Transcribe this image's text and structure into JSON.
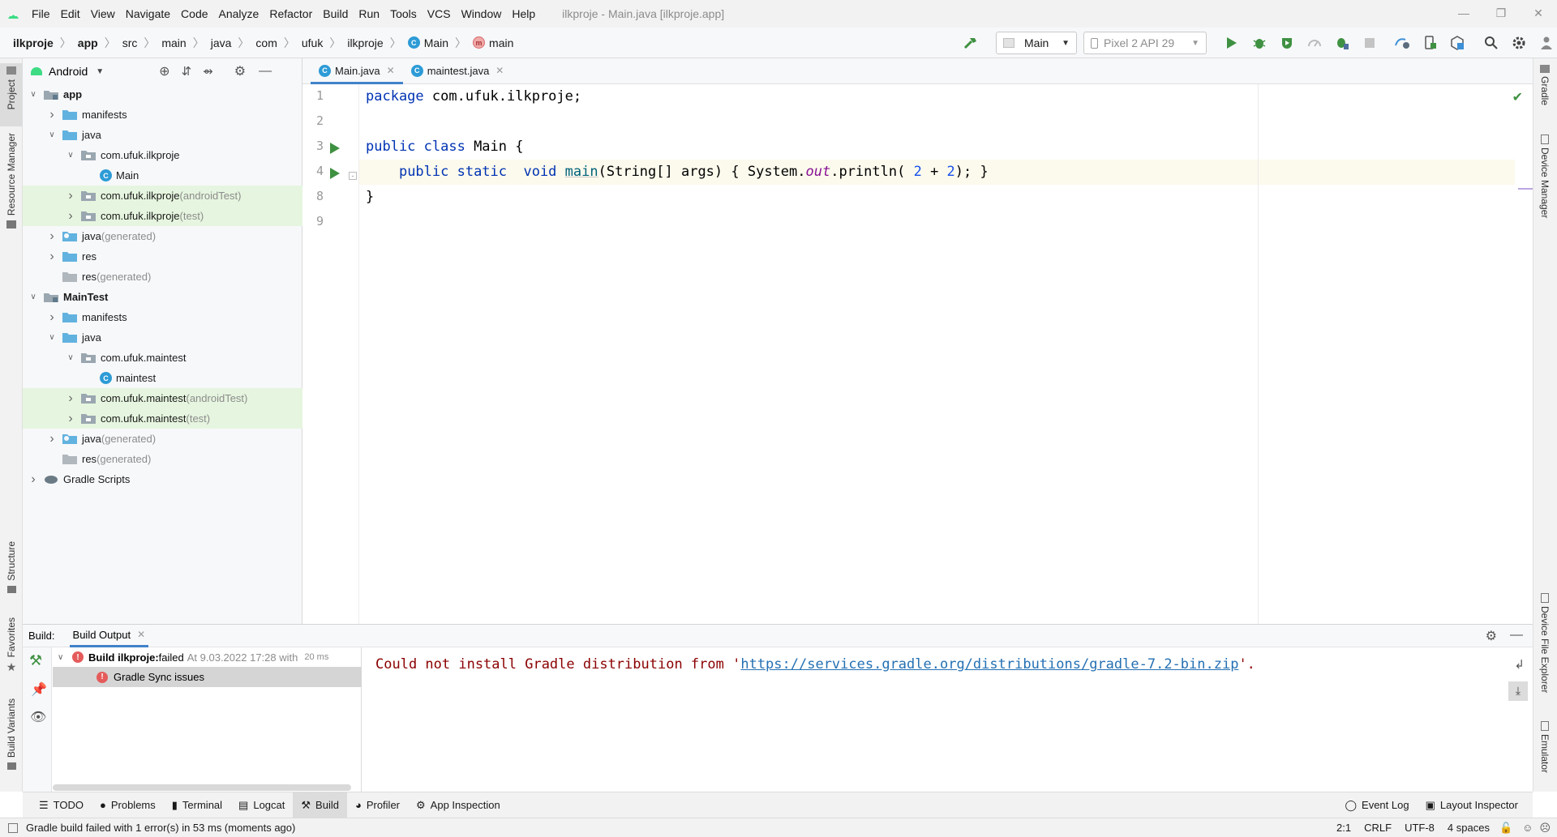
{
  "menubar": {
    "items": [
      "File",
      "Edit",
      "View",
      "Navigate",
      "Code",
      "Analyze",
      "Refactor",
      "Build",
      "Run",
      "Tools",
      "VCS",
      "Window",
      "Help"
    ],
    "window_title": "ilkproje - Main.java [ilkproje.app]"
  },
  "navbar": {
    "breadcrumbs": [
      "ilkproje",
      "app",
      "src",
      "main",
      "java",
      "com",
      "ufuk",
      "ilkproje"
    ],
    "class_crumb": "Main",
    "method_crumb": "main",
    "run_config": "Main",
    "device": "Pixel 2 API 29"
  },
  "left_strip": {
    "project": "Project",
    "resource_manager": "Resource Manager",
    "structure": "Structure",
    "favorites": "Favorites",
    "build_variants": "Build Variants"
  },
  "right_strip": {
    "gradle": "Gradle",
    "device_manager": "Device Manager",
    "device_file_explorer": "Device File Explorer",
    "emulator": "Emulator"
  },
  "project_panel": {
    "view_mode": "Android",
    "tree": [
      {
        "label": "app",
        "suffix": "",
        "bold": true
      },
      {
        "label": "manifests",
        "suffix": ""
      },
      {
        "label": "java",
        "suffix": ""
      },
      {
        "label": "com.ufuk.ilkproje",
        "suffix": ""
      },
      {
        "label": "Main",
        "suffix": ""
      },
      {
        "label": "com.ufuk.ilkproje",
        "suffix": " (androidTest)"
      },
      {
        "label": "com.ufuk.ilkproje",
        "suffix": " (test)"
      },
      {
        "label": "java",
        "suffix": " (generated)"
      },
      {
        "label": "res",
        "suffix": ""
      },
      {
        "label": "res",
        "suffix": " (generated)"
      },
      {
        "label": "MainTest",
        "suffix": "",
        "bold": true
      },
      {
        "label": "manifests",
        "suffix": ""
      },
      {
        "label": "java",
        "suffix": ""
      },
      {
        "label": "com.ufuk.maintest",
        "suffix": ""
      },
      {
        "label": "maintest",
        "suffix": ""
      },
      {
        "label": "com.ufuk.maintest",
        "suffix": " (androidTest)"
      },
      {
        "label": "com.ufuk.maintest",
        "suffix": " (test)"
      },
      {
        "label": "java",
        "suffix": " (generated)"
      },
      {
        "label": "res",
        "suffix": " (generated)"
      },
      {
        "label": "Gradle Scripts",
        "suffix": ""
      }
    ]
  },
  "editor": {
    "tabs": [
      "Main.java",
      "maintest.java"
    ],
    "line_numbers": [
      "1",
      "2",
      "3",
      "4",
      "8",
      "9"
    ],
    "code": {
      "l1_kw": "package",
      "l1_rest": " com.ufuk.ilkproje;",
      "l3_kw": "public class",
      "l3_rest": " Main {",
      "l4_indent": "    ",
      "l4_kw": "public static  void",
      "l4_sp": " ",
      "l4_fn": "main",
      "l4_a": "(String[] args) { System.",
      "l4_out": "out",
      "l4_b": ".println( ",
      "l4_n1": "2",
      "l4_plus": " + ",
      "l4_n2": "2",
      "l4_c": "); }",
      "l8": "}"
    }
  },
  "build_panel": {
    "label": "Build:",
    "tab": "Build Output",
    "tree_item_title": "Build ilkproje:",
    "tree_item_status": " failed",
    "tree_item_time": " At 9.03.2022 17:28 with",
    "tree_item_duration": "20 ms",
    "tree_child": "Gradle Sync issues",
    "output_prefix": "Could not install Gradle distribution from '",
    "output_link": "https://services.gradle.org/distributions/gradle-7.2-bin.zip",
    "output_suffix": "'."
  },
  "bottom_tabs": {
    "left": [
      "TODO",
      "Problems",
      "Terminal",
      "Logcat",
      "Build",
      "Profiler",
      "App Inspection"
    ],
    "right": [
      "Event Log",
      "Layout Inspector"
    ]
  },
  "statusbar": {
    "message": "Gradle build failed with 1 error(s) in 53 ms (moments ago)",
    "position": "2:1",
    "line_sep": "CRLF",
    "encoding": "UTF-8",
    "indent": "4 spaces"
  },
  "colors": {
    "accent": "#4083c9",
    "run_green": "#3f9142",
    "error": "#e55b5b",
    "android_green": "#3ddc84"
  }
}
